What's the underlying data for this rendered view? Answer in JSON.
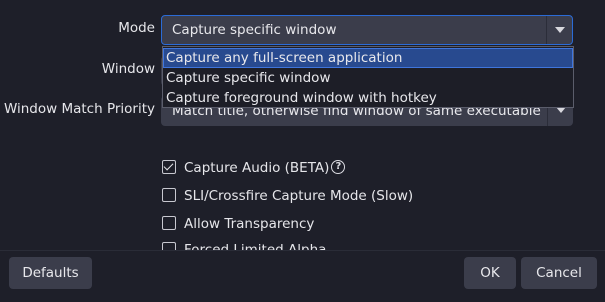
{
  "form": {
    "mode_label": "Mode",
    "mode_value": "Capture specific window",
    "window_label": "Window",
    "priority_label": "Window Match Priority",
    "priority_value": "Match title, otherwise find window of same executable",
    "mode_options": [
      "Capture any full-screen application",
      "Capture specific window",
      "Capture foreground window with hotkey"
    ],
    "highlighted_option_index": 0,
    "checkboxes": [
      {
        "label": "Capture Audio (BETA)",
        "checked": true,
        "has_help": true
      },
      {
        "label": "SLI/Crossfire Capture Mode (Slow)",
        "checked": false
      },
      {
        "label": "Allow Transparency",
        "checked": false
      },
      {
        "label": "Forced Limited Alpha",
        "checked": false
      }
    ],
    "help_glyph": "?"
  },
  "buttons": {
    "defaults": "Defaults",
    "ok": "OK",
    "cancel": "Cancel"
  },
  "colors": {
    "background": "#1e1f29",
    "control": "#3b3d4b",
    "accent": "#2b6bd6",
    "highlight": "#284a8f"
  }
}
